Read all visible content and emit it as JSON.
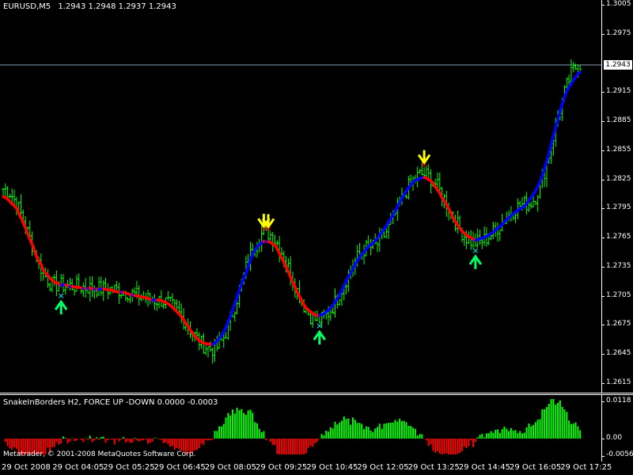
{
  "header": {
    "symbol": "EURUSD,M5",
    "quote": "1.2943 1.2948 1.2937 1.2943"
  },
  "price_axis": {
    "ticks": [
      "1.3005",
      "1.2975",
      "1.2943",
      "1.2915",
      "1.2885",
      "1.2855",
      "1.2825",
      "1.2795",
      "1.2765",
      "1.2735",
      "1.2705",
      "1.2675",
      "1.2645",
      "1.2615"
    ],
    "current_price": "1.2943"
  },
  "indicator": {
    "title": "SnakeInBorders H2, FORCE UP -DOWN  0.0000 -0.0003",
    "axis_ticks": [
      "0.0118",
      "0.00",
      "-0.0056"
    ]
  },
  "footer": {
    "copyright": "Metatrader, © 2001-2008 MetaQuotes Software Corp."
  },
  "time_axis": {
    "labels": [
      "29 Oct 2008",
      "29 Oct 04:05",
      "29 Oct 05:25",
      "29 Oct 06:45",
      "29 Oct 08:05",
      "29 Oct 09:25",
      "29 Oct 10:45",
      "29 Oct 12:05",
      "29 Oct 13:25",
      "29 Oct 14:45",
      "29 Oct 16:05",
      "29 Oct 17:25"
    ]
  },
  "colors": {
    "background": "#000000",
    "candles": "#00ff00",
    "snake_up": "#0000ff",
    "snake_down": "#ff0000",
    "arrow_down": "#ffff00",
    "arrow_up": "#00ff66",
    "hist_up": "#00ff00",
    "hist_down": "#ff0000",
    "marker_cross_top": "#ff0000",
    "marker_cross_bottom": "#00ffff"
  },
  "chart_data": {
    "type": "line",
    "series": [
      {
        "name": "EURUSD,M5",
        "x": [
          "29 Oct 2008",
          "29 Oct 04:05",
          "29 Oct 05:25",
          "29 Oct 06:45",
          "29 Oct 08:05",
          "29 Oct 09:25",
          "29 Oct 10:45",
          "29 Oct 12:05",
          "29 Oct 13:25",
          "29 Oct 14:45",
          "29 Oct 16:05",
          "29 Oct 17:25"
        ],
        "values": [
          1.2815,
          1.2716,
          1.2712,
          1.27,
          1.265,
          1.277,
          1.268,
          1.2755,
          1.283,
          1.276,
          1.28,
          1.2943
        ]
      }
    ],
    "ylim": [
      1.2605,
      1.301
    ]
  }
}
